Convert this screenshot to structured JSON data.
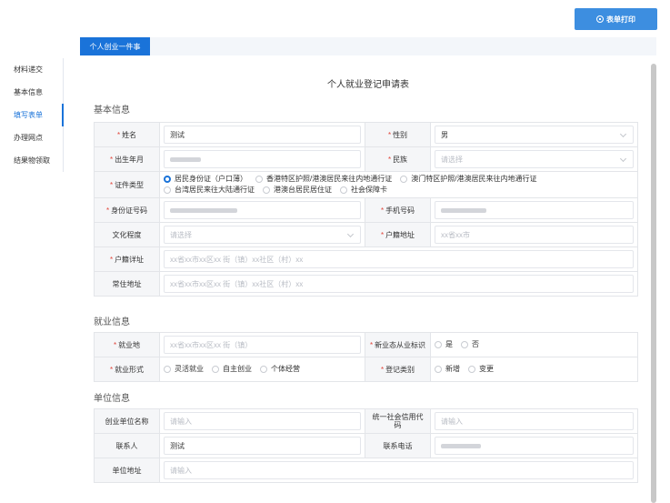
{
  "toolbar": {
    "print_label": "表单打印"
  },
  "tabs": [
    {
      "label": "个人创业一件事"
    }
  ],
  "sidebar": {
    "items": [
      {
        "label": "材料递交"
      },
      {
        "label": "基本信息"
      },
      {
        "label": "填写表单"
      },
      {
        "label": "办理网点"
      },
      {
        "label": "结果物领取"
      }
    ],
    "active_index": 2
  },
  "form": {
    "title": "个人就业登记申请表",
    "sections": {
      "basic": "基本信息",
      "employment": "就业信息",
      "unit": "单位信息"
    },
    "labels": {
      "name": "姓名",
      "gender": "性别",
      "birth": "出生年月",
      "ethnicity": "民族",
      "id_type": "证件类型",
      "id_number": "身份证号码",
      "phone": "手机号码",
      "education": "文化程度",
      "household_addr": "户籍地址",
      "household_detail": "户籍详址",
      "residence": "常住地址",
      "work_place": "就业地",
      "new_form_flag": "新业态从业标识",
      "work_form": "就业形式",
      "reg_type": "登记类别",
      "unit_name": "创业单位名称",
      "credit_code": "统一社会信用代码",
      "contact": "联系人",
      "contact_phone": "联系电话",
      "unit_addr": "单位地址"
    },
    "values": {
      "name": "测试",
      "gender": "男",
      "ethnicity_ph": "请选择",
      "education_ph": "请选择",
      "household_addr_ph": "xx省xx市",
      "household_detail_ph": "xx省xx市xx区xx 街（镇）xx社区（村）xx",
      "residence_ph": "xx省xx市xx区xx 街（镇）xx社区（村）xx",
      "work_place_ph": "xx省xx市xx区xx 街（镇）",
      "unit_name_ph": "请输入",
      "credit_code_ph": "请输入",
      "contact": "测试",
      "unit_addr_ph": "请输入"
    },
    "id_types": [
      {
        "label": "居民身份证（户口薄）",
        "selected": true
      },
      {
        "label": "香港特区护照/港澳居民来往内地通行证",
        "selected": false
      },
      {
        "label": "澳门特区护照/港澳居民来往内地通行证",
        "selected": false
      },
      {
        "label": "台湾居民来往大陆通行证",
        "selected": false
      },
      {
        "label": "港澳台居民居住证",
        "selected": false
      },
      {
        "label": "社会保障卡",
        "selected": false
      }
    ],
    "new_form_options": [
      {
        "label": "是"
      },
      {
        "label": "否"
      }
    ],
    "work_form_options": [
      {
        "label": "灵活就业"
      },
      {
        "label": "自主创业"
      },
      {
        "label": "个体经营"
      }
    ],
    "reg_type_options": [
      {
        "label": "新增"
      },
      {
        "label": "变更"
      }
    ]
  },
  "colors": {
    "accent": "#1a73d9",
    "required": "#e0453a"
  }
}
